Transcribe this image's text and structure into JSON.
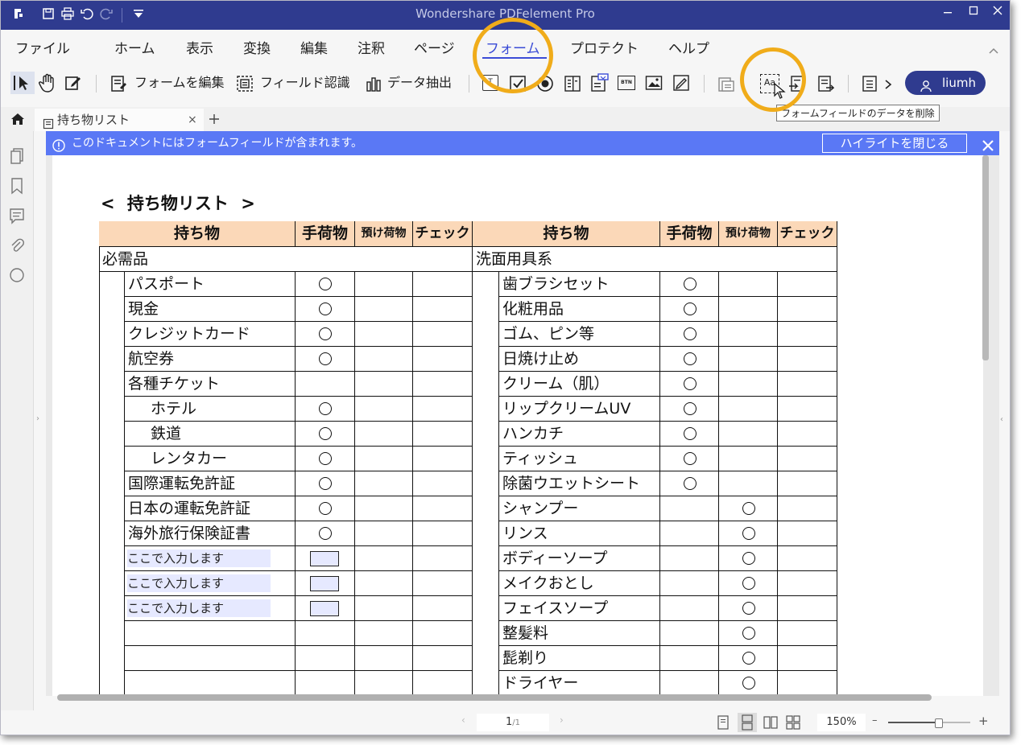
{
  "app": {
    "title": "Wondershare PDFelement Pro"
  },
  "menu": {
    "items": [
      "ファイル",
      "ホーム",
      "表示",
      "変換",
      "編集",
      "注釈",
      "ページ",
      "フォーム",
      "プロテクト",
      "ヘルプ"
    ],
    "active": "フォーム"
  },
  "ribbon": {
    "edit_form": "フォームを編集",
    "field_recognition": "フィールド認識",
    "data_extract": "データ抽出",
    "btn_label": "BTN",
    "text_field_label": "Aa",
    "user": "liumh",
    "tooltip": "フォームフィールドのデータを削除"
  },
  "tab": {
    "label": "持ち物リスト"
  },
  "infobar": {
    "message": "このドキュメントにはフォームフィールドが含まれます。",
    "close_highlight": "ハイライトを閉じる"
  },
  "document": {
    "title": "持ち物リスト",
    "headers": [
      "持ち物",
      "手荷物",
      "預け荷物",
      "チェック"
    ],
    "left_section": "必需品",
    "left_items": [
      "パスポート",
      "現金",
      "クレジットカード",
      "航空券",
      "各種チケット",
      "ホテル",
      "鉄道",
      "レンタカー",
      "国際運転免許証",
      "日本の運転免許証",
      "海外旅行保険証書"
    ],
    "field_placeholder": "ここで入力します",
    "right_section": "洗面用具系",
    "right_items": [
      "歯ブラシセット",
      "化粧用品",
      "ゴム、ピン等",
      "日焼け止め",
      "クリーム（肌）",
      "リップクリームUV",
      "ハンカチ",
      "ティッシュ",
      "除菌ウエットシート",
      "シャンプー",
      "リンス",
      "ボディーソープ",
      "メイクおとし",
      "フェイスソープ",
      "整髪料",
      "髭剃り",
      "ドライヤー"
    ]
  },
  "status": {
    "page": "1",
    "total": "/1",
    "zoom": "150%"
  }
}
